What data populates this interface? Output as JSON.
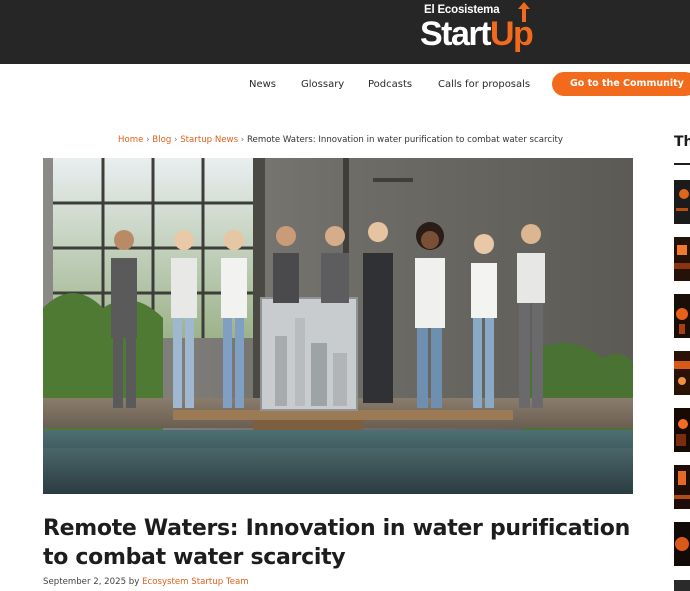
{
  "header": {
    "logo_small": "El Ecosistema",
    "logo_word_white": "Start",
    "logo_word_orange": "Up",
    "brand_color": "#f26a1b",
    "bar_color": "#262626"
  },
  "nav": {
    "items": [
      "News",
      "Glossary",
      "Podcasts",
      "Calls for proposals"
    ],
    "cta": "Go to the Community"
  },
  "breadcrumb": {
    "home": "Home",
    "blog": "Blog",
    "section": "Startup News",
    "current": "Remote Waters: Innovation in water purification to combat water scarcity",
    "separator": "›"
  },
  "article": {
    "image_alt": "Team of professionals standing beside a water purification unit by a reflective pool",
    "title": "Remote Waters: Innovation in water purification to combat water scarcity",
    "date": "September 2, 2025",
    "by": "by",
    "author": "Ecosystem Startup Team"
  },
  "sidebar": {
    "heading": "Th",
    "thumbnail_count_icon": "thumbnail-image"
  }
}
